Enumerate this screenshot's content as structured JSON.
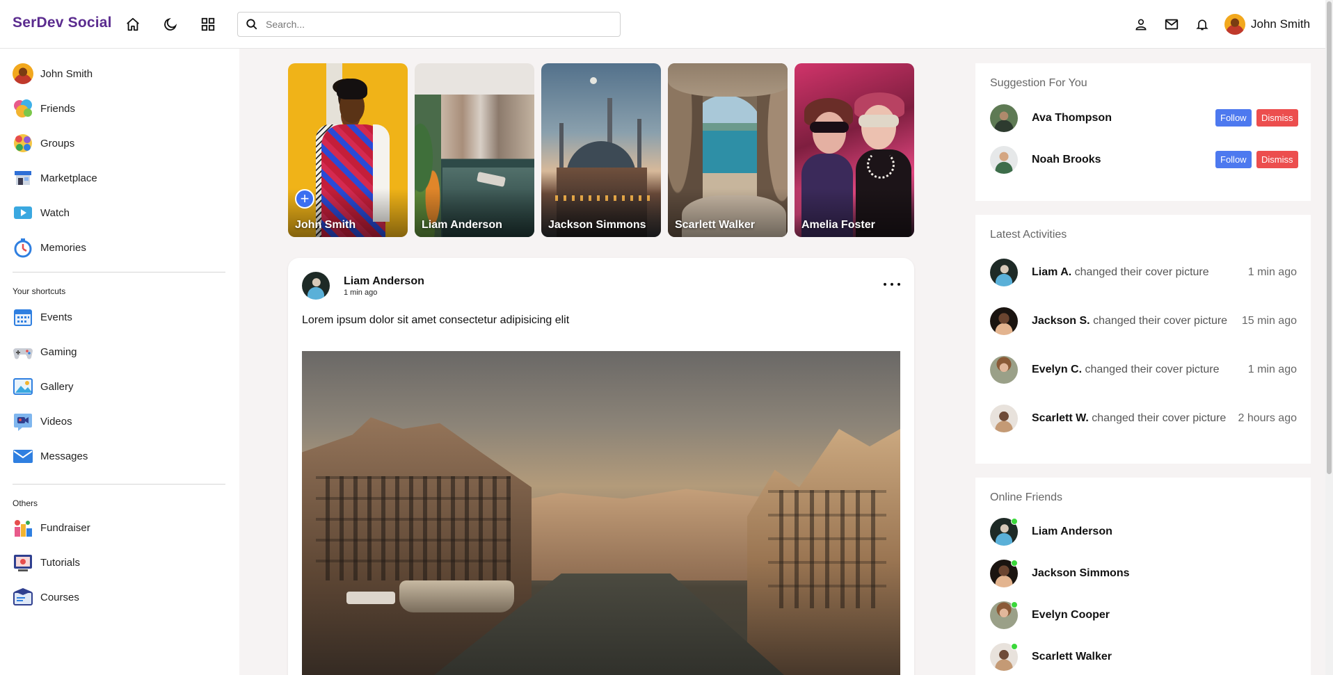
{
  "app": {
    "title": "SerDev Social"
  },
  "search": {
    "placeholder": "Search..."
  },
  "topbar": {
    "icons": [
      "home-icon",
      "moon-icon",
      "grid-icon",
      "person-icon",
      "mail-icon",
      "bell-icon"
    ],
    "user_name": "John Smith"
  },
  "sidebar": {
    "items": [
      {
        "label": "John Smith",
        "icon": "avatar"
      },
      {
        "label": "Friends",
        "icon": "friends-icon"
      },
      {
        "label": "Groups",
        "icon": "groups-icon"
      },
      {
        "label": "Marketplace",
        "icon": "marketplace-icon"
      },
      {
        "label": "Watch",
        "icon": "watch-icon"
      },
      {
        "label": "Memories",
        "icon": "memories-icon"
      }
    ],
    "shortcuts_title": "Your shortcuts",
    "shortcuts": [
      {
        "label": "Events",
        "icon": "events-icon"
      },
      {
        "label": "Gaming",
        "icon": "gaming-icon"
      },
      {
        "label": "Gallery",
        "icon": "gallery-icon"
      },
      {
        "label": "Videos",
        "icon": "videos-icon"
      },
      {
        "label": "Messages",
        "icon": "messages-icon"
      }
    ],
    "others_title": "Others",
    "others": [
      {
        "label": "Fundraiser",
        "icon": "fundraiser-icon"
      },
      {
        "label": "Tutorials",
        "icon": "tutorials-icon"
      },
      {
        "label": "Courses",
        "icon": "courses-icon"
      }
    ]
  },
  "stories": [
    {
      "name": "John Smith",
      "add": "+"
    },
    {
      "name": "Liam Anderson"
    },
    {
      "name": "Jackson Simmons"
    },
    {
      "name": "Scarlett Walker"
    },
    {
      "name": "Amelia Foster"
    }
  ],
  "post": {
    "author": "Liam Anderson",
    "time": "1 min ago",
    "text": "Lorem ipsum dolor sit amet consectetur adipisicing elit"
  },
  "suggestions": {
    "title": "Suggestion For You",
    "follow_label": "Follow",
    "dismiss_label": "Dismiss",
    "people": [
      {
        "name": "Ava Thompson"
      },
      {
        "name": "Noah Brooks"
      }
    ]
  },
  "activities": {
    "title": "Latest Activities",
    "items": [
      {
        "name": "Liam A.",
        "action": "changed their cover picture",
        "time": "1 min ago"
      },
      {
        "name": "Jackson S.",
        "action": "changed their cover picture",
        "time": "15 min ago"
      },
      {
        "name": "Evelyn C.",
        "action": "changed their cover picture",
        "time": "1 min ago"
      },
      {
        "name": "Scarlett W.",
        "action": "changed their cover picture",
        "time": "2 hours ago"
      }
    ]
  },
  "online": {
    "title": "Online Friends",
    "friends": [
      {
        "name": "Liam Anderson"
      },
      {
        "name": "Jackson Simmons"
      },
      {
        "name": "Evelyn Cooper"
      },
      {
        "name": "Scarlett Walker"
      }
    ]
  },
  "colors": {
    "brand": "#5b2c8f",
    "follow": "#4d79ef",
    "dismiss": "#ec4e4e",
    "online": "#3ad83a"
  }
}
